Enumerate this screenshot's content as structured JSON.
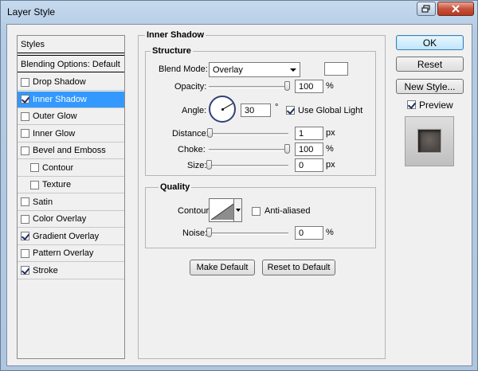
{
  "window": {
    "title": "Layer Style"
  },
  "styles_panel": {
    "header": "Styles",
    "blending_options": "Blending Options: Default",
    "items": [
      {
        "label": "Drop Shadow",
        "checked": false,
        "selected": false,
        "indent": false
      },
      {
        "label": "Inner Shadow",
        "checked": true,
        "selected": true,
        "indent": false
      },
      {
        "label": "Outer Glow",
        "checked": false,
        "selected": false,
        "indent": false
      },
      {
        "label": "Inner Glow",
        "checked": false,
        "selected": false,
        "indent": false
      },
      {
        "label": "Bevel and Emboss",
        "checked": false,
        "selected": false,
        "indent": false
      },
      {
        "label": "Contour",
        "checked": false,
        "selected": false,
        "indent": true
      },
      {
        "label": "Texture",
        "checked": false,
        "selected": false,
        "indent": true
      },
      {
        "label": "Satin",
        "checked": false,
        "selected": false,
        "indent": false
      },
      {
        "label": "Color Overlay",
        "checked": false,
        "selected": false,
        "indent": false
      },
      {
        "label": "Gradient Overlay",
        "checked": true,
        "selected": false,
        "indent": false
      },
      {
        "label": "Pattern Overlay",
        "checked": false,
        "selected": false,
        "indent": false
      },
      {
        "label": "Stroke",
        "checked": true,
        "selected": false,
        "indent": false
      }
    ]
  },
  "inner_shadow": {
    "title": "Inner Shadow",
    "structure": {
      "title": "Structure",
      "blend_mode_label": "Blend Mode:",
      "blend_mode_value": "Overlay",
      "opacity_label": "Opacity:",
      "opacity_value": "100",
      "opacity_level": 100,
      "opacity_unit": "%",
      "angle_label": "Angle:",
      "angle_value": "30",
      "angle_unit": "°",
      "use_global_light_label": "Use Global Light",
      "use_global_light": true,
      "distance_label": "Distance:",
      "distance_value": "1",
      "distance_level": 1,
      "distance_unit": "px",
      "choke_label": "Choke:",
      "choke_value": "100",
      "choke_level": 100,
      "choke_unit": "%",
      "size_label": "Size:",
      "size_value": "0",
      "size_level": 0,
      "size_unit": "px"
    },
    "quality": {
      "title": "Quality",
      "contour_label": "Contour:",
      "anti_aliased_label": "Anti-aliased",
      "anti_aliased": false,
      "noise_label": "Noise:",
      "noise_value": "0",
      "noise_level": 0,
      "noise_unit": "%"
    },
    "make_default_label": "Make Default",
    "reset_default_label": "Reset to Default"
  },
  "actions": {
    "ok_label": "OK",
    "reset_label": "Reset",
    "new_style_label": "New Style...",
    "preview_label": "Preview",
    "preview_checked": true
  },
  "colors": {
    "selection": "#3399ff",
    "shadow_color": "#ffffff"
  }
}
